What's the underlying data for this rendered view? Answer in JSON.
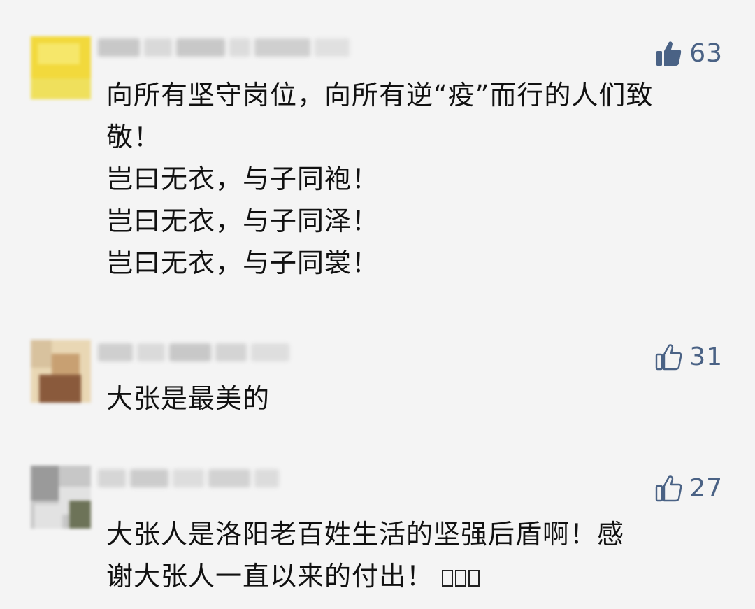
{
  "comments": [
    {
      "likes": "63",
      "like_state": "liked",
      "lines": [
        "向所有坚守岗位，向所有逆“疫”而行的人们致",
        "敬！",
        "岂曰无衣，与子同袍！",
        "岂曰无衣，与子同泽！",
        "岂曰无衣，与子同裳！"
      ],
      "avatar_colors": [
        "#f5e14a",
        "#f2d93c",
        "#efe05c",
        "#f6e76a"
      ]
    },
    {
      "likes": "31",
      "like_state": "not-liked",
      "lines": [
        "大张是最美的"
      ],
      "avatar_colors": [
        "#e9d7b4",
        "#c8a072",
        "#8a5a3c",
        "#d8c29e"
      ]
    },
    {
      "likes": "27",
      "like_state": "not-liked",
      "lines": [
        "大张人是洛阳老百姓生活的坚强后盾啊！感",
        "谢大张人一直以来的付出！"
      ],
      "emoji_icons": [
        "unknown-emoji-icon",
        "unknown-emoji-icon",
        "unknown-emoji-icon"
      ],
      "avatar_colors": [
        "#9a9a9a",
        "#e2e2e2",
        "#6d7358",
        "#c7c7c7"
      ]
    }
  ],
  "colors": {
    "background": "#f4f4f4",
    "like_accent": "#4a6285",
    "text": "#111111"
  }
}
